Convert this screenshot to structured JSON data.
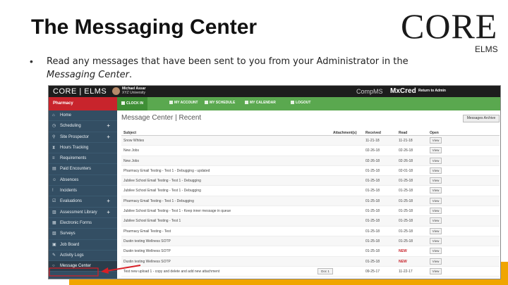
{
  "slide": {
    "title": "The Messaging Center",
    "bullet_prefix": "Read any messages that have been sent to you from your Administrator in the",
    "bullet_italic": "Messaging Center",
    "bullet_suffix": ".",
    "logo_main": "CORE",
    "logo_sub": "ELMS",
    "accent_color": "#f0a500"
  },
  "app": {
    "brand": "CORE | ELMS",
    "user_name": "Michael Assar",
    "user_school": "XYZ University",
    "product_1": "CompMS",
    "product_2": "MxCred",
    "switch_text": "Return to Admin",
    "program": "Pharmacy",
    "colors": {
      "sidebar": "#334e63",
      "nav": "#5aa84f",
      "program": "#c8242c"
    }
  },
  "nav": [
    {
      "label": "CLOCK IN",
      "icon": "clock-icon"
    },
    {
      "label": "MY ACCOUNT",
      "icon": "user-icon"
    },
    {
      "label": "MY SCHEDULE",
      "icon": "people-icon"
    },
    {
      "label": "MY CALENDAR",
      "icon": "calendar-icon"
    },
    {
      "label": "LOGOUT",
      "icon": "logout-icon"
    }
  ],
  "sidebar": [
    {
      "label": "Home",
      "icon": "home-icon",
      "plus": ""
    },
    {
      "label": "Scheduling",
      "icon": "clock-icon",
      "plus": "+"
    },
    {
      "label": "Site Prospector",
      "icon": "search-icon",
      "plus": "+"
    },
    {
      "label": "Hours Tracking",
      "icon": "hourglass-icon",
      "plus": ""
    },
    {
      "label": "Requirements",
      "icon": "list-icon",
      "plus": ""
    },
    {
      "label": "Paid Encounters",
      "icon": "book-icon",
      "plus": ""
    },
    {
      "label": "Absences",
      "icon": "people-icon",
      "plus": ""
    },
    {
      "label": "Incidents",
      "icon": "alert-icon",
      "plus": ""
    },
    {
      "label": "Evaluations",
      "icon": "checklist-icon",
      "plus": "+"
    },
    {
      "label": "Assessment Library",
      "icon": "library-icon",
      "plus": "+"
    },
    {
      "label": "Electronic Forms",
      "icon": "form-icon",
      "plus": ""
    },
    {
      "label": "Surveys",
      "icon": "survey-icon",
      "plus": ""
    },
    {
      "label": "Job Board",
      "icon": "briefcase-icon",
      "plus": ""
    },
    {
      "label": "Activity Logs",
      "icon": "log-icon",
      "plus": ""
    },
    {
      "label": "Message Center",
      "icon": "circle-icon",
      "plus": ""
    }
  ],
  "messages": {
    "page_title": "Message Center | Recent",
    "archive_button": "Messages Archive",
    "headers": {
      "subject": "Subject",
      "attachments": "Attachment(s)",
      "received": "Received",
      "read": "Read",
      "open": "Open"
    },
    "view_label": "View",
    "rows": [
      {
        "subject": "Snow Whites",
        "attachment": "",
        "received": "11-21-18",
        "read": "11-21-18"
      },
      {
        "subject": "New Jobs",
        "attachment": "",
        "received": "02-26-18",
        "read": "02-26-18"
      },
      {
        "subject": "New Jobs",
        "attachment": "",
        "received": "02-26-18",
        "read": "02-26-18"
      },
      {
        "subject": "Pharmacy Email Testing - Test 1 - Debugging - updated",
        "attachment": "",
        "received": "01-25-18",
        "read": "02-01-18"
      },
      {
        "subject": "Jubilee School Email Testing - Test 1 - Debugging",
        "attachment": "",
        "received": "01-25-18",
        "read": "01-25-18"
      },
      {
        "subject": "Jubilee School Email Testing - Test 1 - Debugging",
        "attachment": "",
        "received": "01-25-18",
        "read": "01-25-18"
      },
      {
        "subject": "Pharmacy Email Testing - Test 1 - Debugging",
        "attachment": "",
        "received": "01-25-18",
        "read": "01-25-18"
      },
      {
        "subject": "Jubilee School Email Testing - Test 1 - Keep inner message in queue",
        "attachment": "",
        "received": "01-25-18",
        "read": "01-25-18"
      },
      {
        "subject": "Jubilee School Email Testing - Test 1",
        "attachment": "",
        "received": "01-25-18",
        "read": "01-25-18"
      },
      {
        "subject": "Pharmacy Email Testing - Test",
        "attachment": "",
        "received": "01-25-18",
        "read": "01-25-18"
      },
      {
        "subject": "Dustin testing Wellness SOTP",
        "attachment": "",
        "received": "01-25-18",
        "read": "01-25-18"
      },
      {
        "subject": "Dustin testing Wellness SOTP",
        "attachment": "",
        "received": "01-25-18",
        "read": "NEW"
      },
      {
        "subject": "Dustin testing Wellness SOTP",
        "attachment": "",
        "received": "01-25-18",
        "read": "NEW"
      },
      {
        "subject": "Test new upload 1 - copy and delete and add new attachment",
        "attachment": "Doc 1",
        "received": "09-25-17",
        "read": "11-22-17"
      }
    ]
  }
}
